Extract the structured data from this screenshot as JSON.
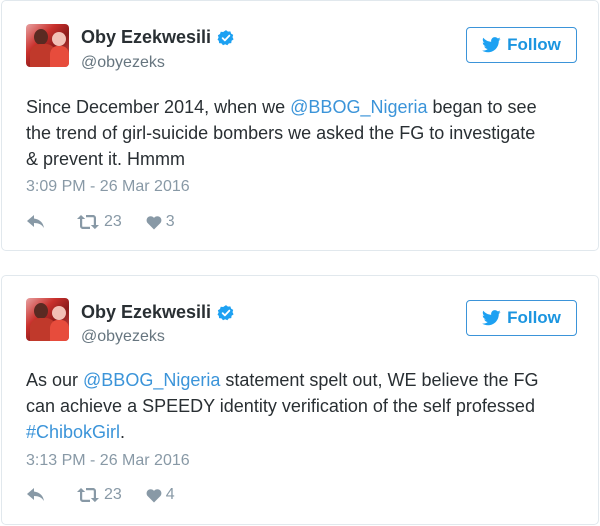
{
  "colors": {
    "link": "#3b94d9",
    "follow": "#1b95e0",
    "muted": "#8899a6",
    "text": "#292f33"
  },
  "tweets": [
    {
      "author": {
        "name": "Oby Ezekwesili",
        "handle": "@obyezeks",
        "verified_icon": "verified-badge-icon"
      },
      "follow_label": "Follow",
      "text": {
        "line1_pre": "Since December 2014, when we ",
        "line1_link": "@BBOG_Nigeria",
        "line1_post": " began to see",
        "line2": "the trend of girl-suicide bombers we asked the FG to investigate",
        "line3": "& prevent it. Hmmm"
      },
      "timestamp": "3:09 PM - 26 Mar 2016",
      "retweets": "23",
      "likes": "3"
    },
    {
      "author": {
        "name": "Oby Ezekwesili",
        "handle": "@obyezeks",
        "verified_icon": "verified-badge-icon"
      },
      "follow_label": "Follow",
      "text": {
        "line1_pre": "As our ",
        "line1_link": "@BBOG_Nigeria",
        "line1_post": " statement spelt out, WE believe the FG",
        "line2": "can achieve a SPEEDY identity verification of the self professed",
        "line3_link": "#ChibokGirl",
        "line3_post": "."
      },
      "timestamp": "3:13 PM - 26 Mar 2016",
      "retweets": "23",
      "likes": "4"
    }
  ]
}
